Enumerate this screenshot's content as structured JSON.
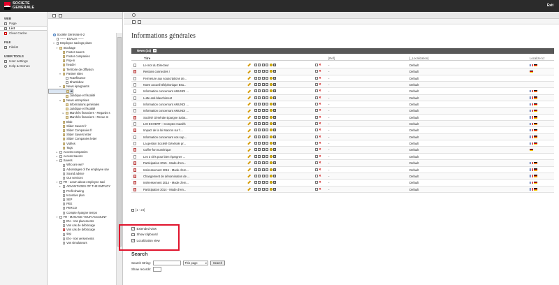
{
  "header": {
    "logo_line1": "SOCIETE",
    "logo_line2": "GENERALE",
    "exit_label": "Exit"
  },
  "leftnav": {
    "sections": [
      {
        "title": "WEB",
        "items": [
          {
            "label": "Page",
            "icon": "page-icon",
            "active": false
          },
          {
            "label": "List",
            "icon": "list-icon",
            "active": true
          },
          {
            "label": "Clear Cache",
            "icon": "clear-cache-icon",
            "active": false
          }
        ]
      },
      {
        "title": "FILE",
        "items": [
          {
            "label": "Filelist",
            "icon": "folder-icon",
            "active": false
          }
        ]
      },
      {
        "title": "USER TOOLS",
        "items": [
          {
            "label": "User settings",
            "icon": "user-icon",
            "active": false
          },
          {
            "label": "Help & Demos",
            "icon": "help-icon",
            "active": false
          }
        ]
      }
    ]
  },
  "tree": {
    "items": [
      {
        "label": "Société Générale 6-2",
        "indent": 0,
        "toggle": "",
        "icon": "globe"
      },
      {
        "label": "------ ESALIA ------",
        "indent": 1,
        "toggle": "",
        "icon": "page"
      },
      {
        "label": "Employee savings plans",
        "indent": 1,
        "toggle": "▾",
        "icon": "page"
      },
      {
        "label": "Stockage",
        "indent": 2,
        "toggle": "▾",
        "icon": "folder"
      },
      {
        "label": "Footer savers",
        "indent": 3,
        "toggle": "",
        "icon": "folder"
      },
      {
        "label": "Footer companies",
        "indent": 3,
        "toggle": "",
        "icon": "folder"
      },
      {
        "label": "Pop-in",
        "indent": 3,
        "toggle": "",
        "icon": "folder"
      },
      {
        "label": "header",
        "indent": 3,
        "toggle": "",
        "icon": "folder"
      },
      {
        "label": "Territoire de diffusion",
        "indent": 3,
        "toggle": "",
        "icon": "folder"
      },
      {
        "label": "Partner sites",
        "indent": 3,
        "toggle": "▾",
        "icon": "folder"
      },
      {
        "label": "#cartfinance",
        "indent": 4,
        "toggle": "",
        "icon": "page"
      },
      {
        "label": "Shartinbox",
        "indent": 4,
        "toggle": "",
        "icon": "page"
      },
      {
        "label": "News épargnants",
        "indent": 3,
        "toggle": "▾",
        "icon": "folder"
      },
      {
        "label": "Informations générales",
        "indent": 4,
        "toggle": "",
        "icon": "folder",
        "selected": true
      },
      {
        "label": "Juridique et fiscalité",
        "indent": 4,
        "toggle": "",
        "icon": "folder"
      },
      {
        "label": "News entreprises",
        "indent": 3,
        "toggle": "▾",
        "icon": "folder"
      },
      {
        "label": "Informations générales",
        "indent": 4,
        "toggle": "",
        "icon": "folder"
      },
      {
        "label": "Juridique et fiscalité",
        "indent": 4,
        "toggle": "",
        "icon": "folder"
      },
      {
        "label": "Marchés financiers - Regards s",
        "indent": 4,
        "toggle": "▸",
        "icon": "folder"
      },
      {
        "label": "Marchés financiers - Revue m",
        "indent": 4,
        "toggle": "",
        "icon": "folder"
      },
      {
        "label": "Blob",
        "indent": 3,
        "toggle": "",
        "icon": "folder"
      },
      {
        "label": "Slider Savers fr",
        "indent": 3,
        "toggle": "",
        "icon": "folder"
      },
      {
        "label": "Slider Companies fr",
        "indent": 3,
        "toggle": "",
        "icon": "folder"
      },
      {
        "label": "Slider Savers letter",
        "indent": 3,
        "toggle": "",
        "icon": "folder"
      },
      {
        "label": "Slider Companies letter",
        "indent": 3,
        "toggle": "",
        "icon": "folder"
      },
      {
        "label": "Vidéos",
        "indent": 3,
        "toggle": "",
        "icon": "folder"
      },
      {
        "label": "Tags",
        "indent": 3,
        "toggle": "",
        "icon": "folder"
      },
      {
        "label": "Access companies",
        "indent": 2,
        "toggle": "▸",
        "icon": "page"
      },
      {
        "label": "Access Savers",
        "indent": 2,
        "toggle": "▸",
        "icon": "page"
      },
      {
        "label": "Savers",
        "indent": 2,
        "toggle": "▾",
        "icon": "page"
      },
      {
        "label": "Who are we?",
        "indent": 3,
        "toggle": "",
        "icon": "page"
      },
      {
        "label": "Advantages of the employee sav",
        "indent": 3,
        "toggle": "",
        "icon": "page"
      },
      {
        "label": "Sound advice",
        "indent": 3,
        "toggle": "",
        "icon": "page"
      },
      {
        "label": "Our services",
        "indent": 3,
        "toggle": "",
        "icon": "page"
      },
      {
        "label": "FR - Learn about employee savi",
        "indent": 2,
        "toggle": "▾",
        "icon": "page"
      },
      {
        "label": "ADVANTAGES OF THE EMPLOY",
        "indent": 3,
        "toggle": "▸",
        "icon": "page"
      },
      {
        "label": "Profit-sharing",
        "indent": 3,
        "toggle": "",
        "icon": "page"
      },
      {
        "label": "Incentive plan",
        "indent": 3,
        "toggle": "",
        "icon": "page"
      },
      {
        "label": "SEP",
        "indent": 3,
        "toggle": "",
        "icon": "page"
      },
      {
        "label": "PEE",
        "indent": 3,
        "toggle": "",
        "icon": "page"
      },
      {
        "label": "PERCO",
        "indent": 3,
        "toggle": "",
        "icon": "page"
      },
      {
        "label": "Compte épargne temps",
        "indent": 3,
        "toggle": "",
        "icon": "page"
      },
      {
        "label": "FR - MANAGE YOUR ACCOUNT",
        "indent": 2,
        "toggle": "▾",
        "icon": "page"
      },
      {
        "label": "EN - Vos placements",
        "indent": 3,
        "toggle": "",
        "icon": "page"
      },
      {
        "label": "Vos cas de déblocage",
        "indent": 3,
        "toggle": "",
        "icon": "page"
      },
      {
        "label": "Vos cas de déblocage",
        "indent": 3,
        "toggle": "",
        "icon": "red"
      },
      {
        "label": "sep",
        "indent": 3,
        "toggle": "",
        "icon": "page"
      },
      {
        "label": "EN - Vos versements",
        "indent": 3,
        "toggle": "",
        "icon": "page"
      },
      {
        "label": "Vos simulateurs",
        "indent": 3,
        "toggle": "",
        "icon": "page"
      }
    ]
  },
  "main": {
    "title": "Informations générales",
    "list_header": "News (24)",
    "list_header_add": "+",
    "columns": {
      "title": "Titre",
      "ref": "[Ref]",
      "loc": "[_Localization]",
      "localize": "Localize to:"
    },
    "rows": [
      {
        "title": "Le mot du Directeur",
        "ref": "-",
        "loc": "Default",
        "red": false,
        "flags": [
          "fr",
          "de"
        ]
      },
      {
        "title": "Restons connectés !",
        "ref": "-",
        "loc": "Default",
        "red": true,
        "flags": [
          "de"
        ]
      },
      {
        "title": "Fermeture aux souscriptions de...",
        "ref": "-",
        "loc": "Default",
        "red": false,
        "flags": []
      },
      {
        "title": "Notre accueil téléphonique Esa...",
        "ref": "-",
        "loc": "Default",
        "red": false,
        "flags": []
      },
      {
        "title": "Information concernant AMUNDI ...",
        "ref": "-",
        "loc": "Default",
        "red": false,
        "flags": [
          "fr",
          "de"
        ]
      },
      {
        "title": "Lutte anti-blanchiment",
        "ref": "-",
        "loc": "Default",
        "red": false,
        "flags": [
          "fr",
          "de"
        ]
      },
      {
        "title": "Information concernant AMUNDI ...",
        "ref": "-",
        "loc": "Default",
        "red": false,
        "flags": [
          "fr",
          "de"
        ]
      },
      {
        "title": "Information concernant AMUNDI ...",
        "ref": "-",
        "loc": "Default",
        "red": false,
        "flags": [
          "fr",
          "de"
        ]
      },
      {
        "title": "Société Générale Epargne Salar...",
        "ref": "-",
        "loc": "Default",
        "red": true,
        "flags": [
          "fr",
          "de"
        ]
      },
      {
        "title": "LOI ECVERT – Comptes Inactifs",
        "ref": "-",
        "loc": "Default",
        "red": false,
        "flags": [
          "fr",
          "de"
        ]
      },
      {
        "title": "Impact de la loi Macron sur l'...",
        "ref": "-",
        "loc": "Default",
        "red": true,
        "flags": [
          "fr",
          "de"
        ]
      },
      {
        "title": "Information concernant vos sup...",
        "ref": "-",
        "loc": "Default",
        "red": false,
        "flags": [
          "fr",
          "de"
        ]
      },
      {
        "title": "La gestion Société Générale pr...",
        "ref": "-",
        "loc": "Default",
        "red": false,
        "flags": [
          "fr",
          "de"
        ]
      },
      {
        "title": "Coffre-fort numérique",
        "ref": "-",
        "loc": "Default",
        "red": true,
        "flags": [
          "de"
        ]
      },
      {
        "title": "Les 3 clés pour bien épargner ...",
        "ref": "-",
        "loc": "Default",
        "red": false,
        "flags": []
      },
      {
        "title": "Participation 2015 - Mode d'em...",
        "ref": "-",
        "loc": "Default",
        "red": true,
        "flags": [
          "fr",
          "de"
        ]
      },
      {
        "title": "Intéressement 2015 - Mode d'em...",
        "ref": "-",
        "loc": "Default",
        "red": true,
        "flags": [
          "fr",
          "de"
        ]
      },
      {
        "title": "Changement de dénomination de ...",
        "ref": "-",
        "loc": "Default",
        "red": true,
        "flags": [
          "fr",
          "de"
        ]
      },
      {
        "title": "Intéressement 2014 - Mode d'em...",
        "ref": "-",
        "loc": "Default",
        "red": true,
        "flags": [
          "fr",
          "de"
        ]
      },
      {
        "title": "Participation 2014 - Mode d'em...",
        "ref": "-",
        "loc": "Default",
        "red": true,
        "flags": [
          "fr",
          "de"
        ]
      }
    ],
    "pager": "[1 - 24]",
    "options": [
      {
        "label": "Extended view",
        "checked": true
      },
      {
        "label": "Show clipboard",
        "checked": false
      },
      {
        "label": "Localization view",
        "checked": true
      }
    ],
    "search": {
      "title": "Search",
      "string_label": "Search String:",
      "scope_value": "This page",
      "button_label": "Search",
      "show_records_label": "Show records:"
    }
  },
  "colors": {
    "topbar": "#2b2b2b",
    "brand_red": "#e60028",
    "highlight": "#e0132c"
  }
}
